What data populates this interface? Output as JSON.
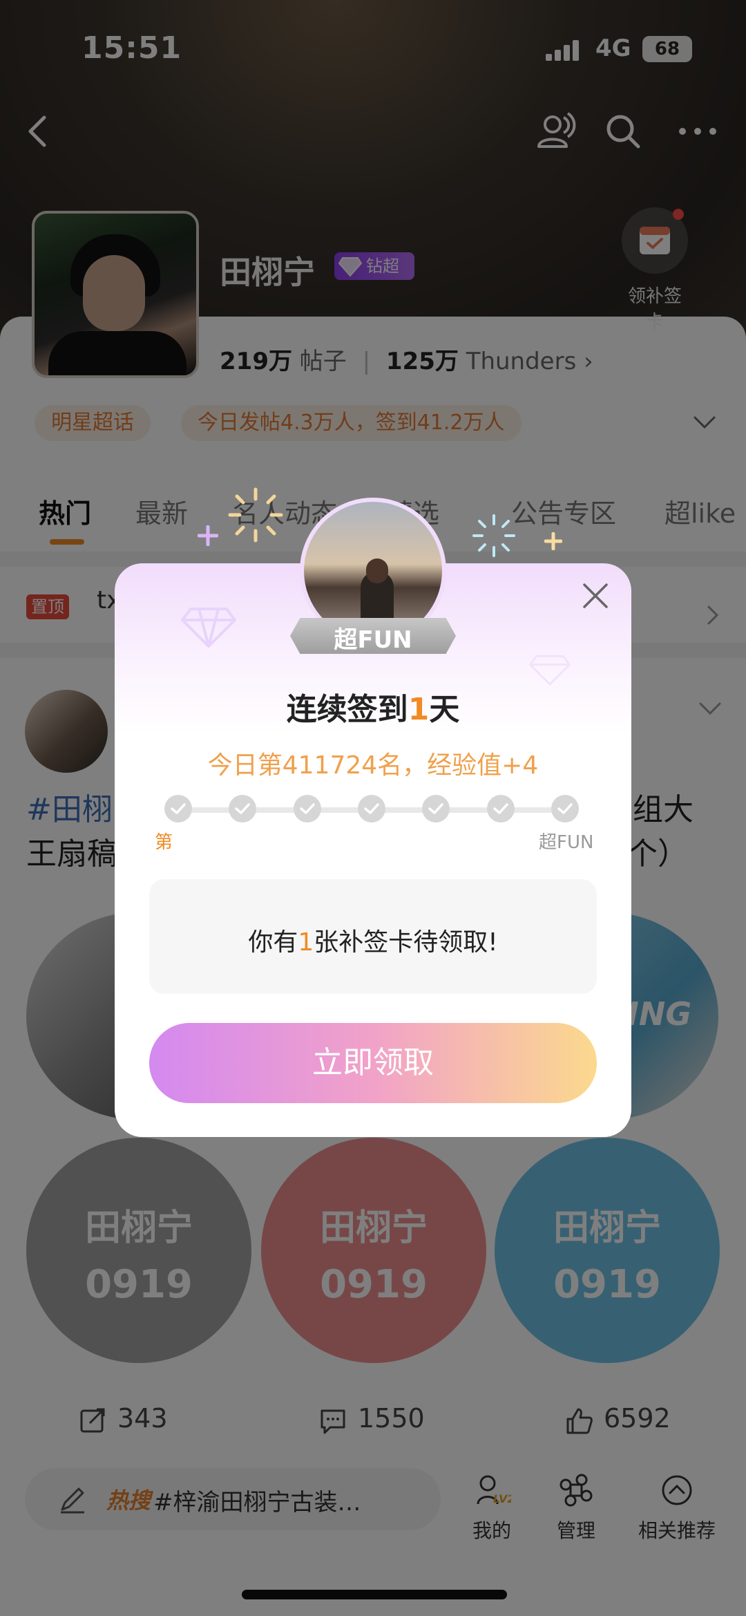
{
  "status_bar": {
    "time": "15:51",
    "network": "4G",
    "battery": "68"
  },
  "profile": {
    "name": "田栩宁",
    "badge": "钻超",
    "posts_count": "219万",
    "posts_label": "帖子",
    "fans_count": "125万",
    "fans_label": "Thunders",
    "checkin_card_label": "领补签卡"
  },
  "tags": {
    "category": "明星超话",
    "daily": "今日发帖4.3万人，签到41.2万人"
  },
  "tabs": [
    "热门",
    "最新",
    "名人动态",
    "精选",
    "公告专区",
    "超like"
  ],
  "pinned": {
    "badge": "置顶",
    "text": "tx"
  },
  "post": {
    "line1_left": "#田栩",
    "line1_right": "组大",
    "line2_left": "王扇稿",
    "line2_right": "个）",
    "circle_right_text": "GING"
  },
  "grid_circles": [
    {
      "name": "田栩宁",
      "date": "0919"
    },
    {
      "name": "田栩宁",
      "date": "0919"
    },
    {
      "name": "田栩宁",
      "date": "0919"
    }
  ],
  "actions": {
    "share": "343",
    "comment": "1550",
    "like": "6592"
  },
  "bottom": {
    "hot_label": "热搜",
    "topic": "#梓渝田栩宁古装…",
    "nav": [
      "我的",
      "管理",
      "相关推荐"
    ]
  },
  "modal": {
    "level_label": "超FUN",
    "title_prefix": "连续签到",
    "title_days": "1",
    "title_suffix": "天",
    "subtitle": "今日第411724名，经验值+4",
    "progress_left": "第",
    "progress_right": "超FUN",
    "notice_prefix": "你有",
    "notice_count": "1",
    "notice_suffix": "张补签卡待领取!",
    "claim_button": "立即领取"
  },
  "colors": {
    "accent_orange": "#f08a24",
    "brand_purple": "#9b4df2",
    "hashtag_blue": "#3f6fb6"
  }
}
